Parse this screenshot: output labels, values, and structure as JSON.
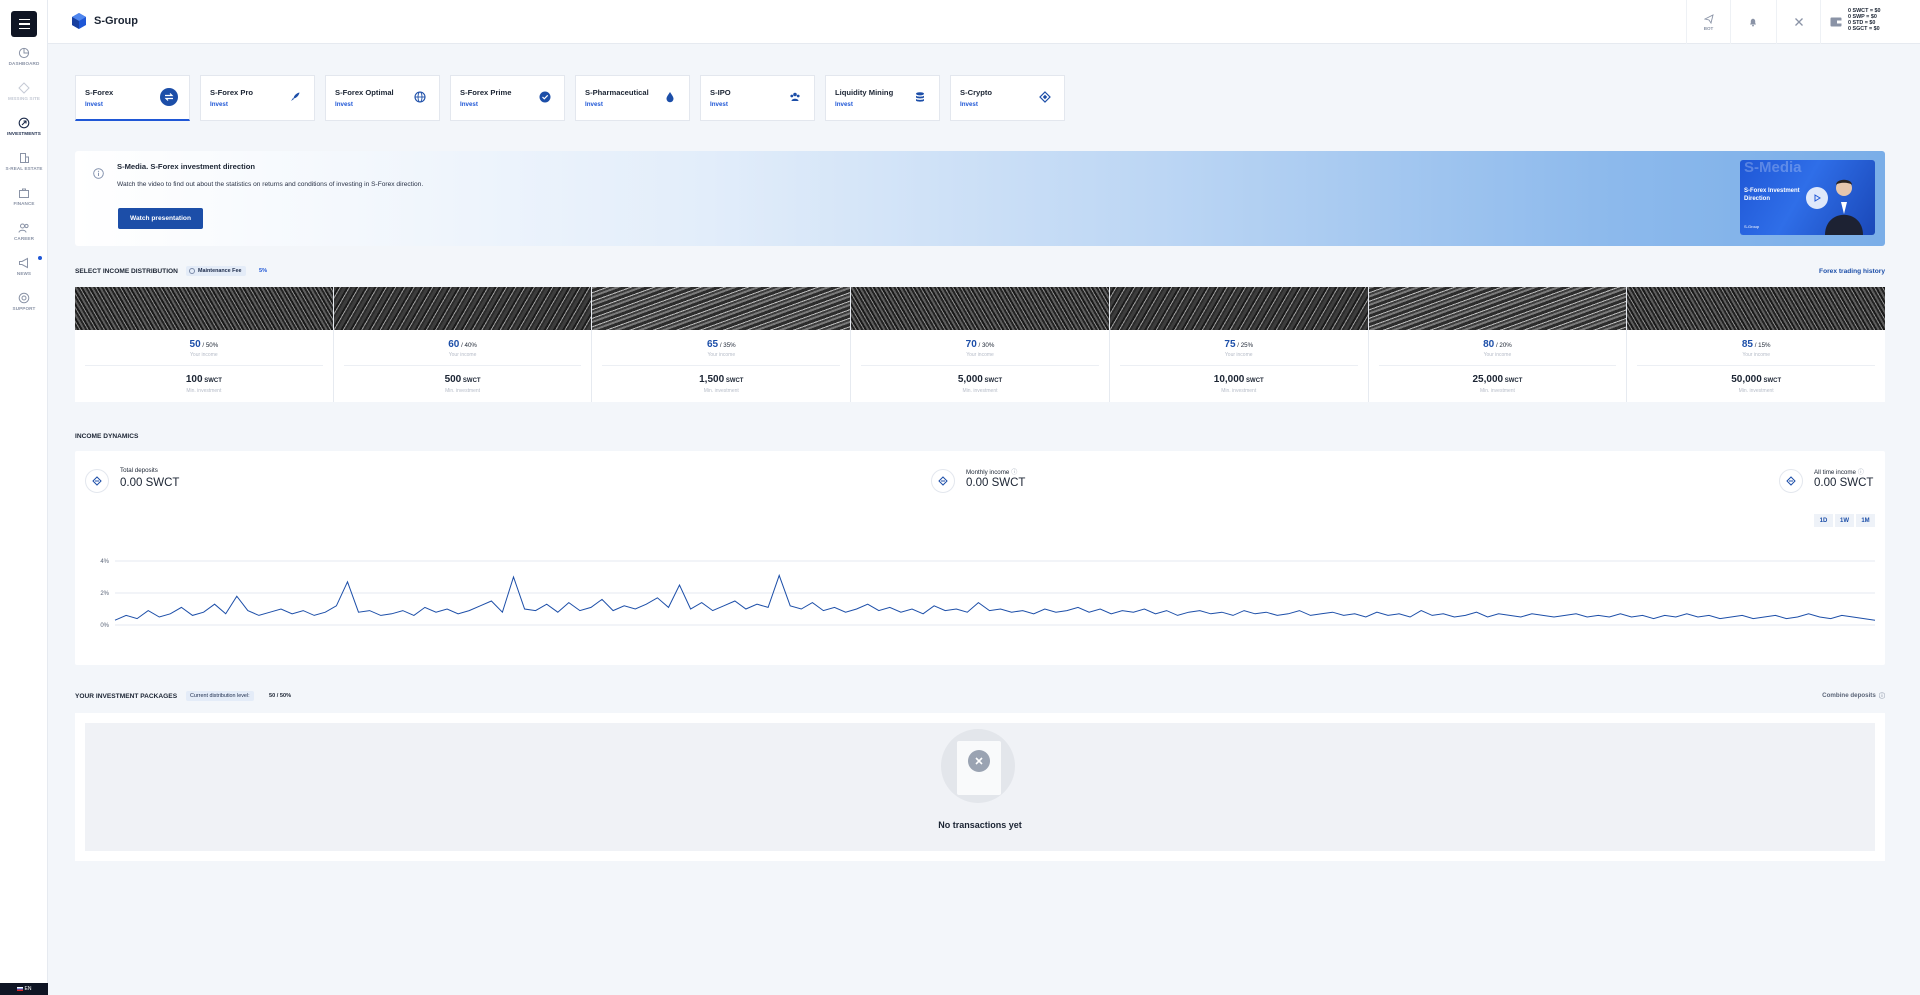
{
  "app": {
    "name": "S-Group"
  },
  "sidebar": {
    "items": [
      {
        "label": "DASHBOARD",
        "icon": "dashboard-icon"
      },
      {
        "label": "MISSING SITE",
        "icon": "diamond-icon"
      },
      {
        "label": "INVESTMENTS",
        "icon": "investments-icon"
      },
      {
        "label": "S-REAL ESTATE",
        "icon": "building-icon"
      },
      {
        "label": "FINANCE",
        "icon": "briefcase-icon"
      },
      {
        "label": "CAREER",
        "icon": "people-icon"
      },
      {
        "label": "NEWS",
        "icon": "megaphone-icon"
      },
      {
        "label": "SUPPORT",
        "icon": "support-icon"
      }
    ],
    "language": "EN"
  },
  "header": {
    "bot_label": "BOT",
    "wallet": [
      "0 SWCT = $0",
      "0 SWP = $0",
      "0 STD = $0",
      "0 SGCT = $0"
    ]
  },
  "tabs": [
    {
      "title": "S-Forex",
      "sub": "Invest",
      "icon": "exchange-icon"
    },
    {
      "title": "S-Forex Pro",
      "sub": "Invest",
      "icon": "rocket-icon"
    },
    {
      "title": "S-Forex Optimal",
      "sub": "Invest",
      "icon": "globe-icon"
    },
    {
      "title": "S-Forex Prime",
      "sub": "Invest",
      "icon": "check-badge-icon"
    },
    {
      "title": "S-Pharmaceutical",
      "sub": "Invest",
      "icon": "drop-icon"
    },
    {
      "title": "S-IPO",
      "sub": "Invest",
      "icon": "group-icon"
    },
    {
      "title": "Liquidity Mining",
      "sub": "Invest",
      "icon": "coins-icon"
    },
    {
      "title": "S-Crypto",
      "sub": "Invest",
      "icon": "crypto-icon"
    }
  ],
  "banner": {
    "title": "S-Media. S-Forex investment direction",
    "text": "Watch the video to find out about the statistics on returns and conditions of investing in S-Forex direction.",
    "button": "Watch presentation",
    "video_brand": "S-Media",
    "video_title": "S-Forex Investment Direction",
    "video_logo": "S-Group"
  },
  "distribution": {
    "title": "SELECT INCOME DISTRIBUTION",
    "fee_label": "Maintenance Fee",
    "fee_value": "5%",
    "link": "Forex trading history",
    "cards": [
      {
        "income": "50",
        "split": "/ 50%",
        "income_label": "Your income",
        "min": "100",
        "unit": "SWCT",
        "min_label": "Min. investment"
      },
      {
        "income": "60",
        "split": "/ 40%",
        "income_label": "Your income",
        "min": "500",
        "unit": "SWCT",
        "min_label": "Min. investment"
      },
      {
        "income": "65",
        "split": "/ 35%",
        "income_label": "Your income",
        "min": "1,500",
        "unit": "SWCT",
        "min_label": "Min. investment"
      },
      {
        "income": "70",
        "split": "/ 30%",
        "income_label": "Your income",
        "min": "5,000",
        "unit": "SWCT",
        "min_label": "Min. investment"
      },
      {
        "income": "75",
        "split": "/ 25%",
        "income_label": "Your income",
        "min": "10,000",
        "unit": "SWCT",
        "min_label": "Min. investment"
      },
      {
        "income": "80",
        "split": "/ 20%",
        "income_label": "Your income",
        "min": "25,000",
        "unit": "SWCT",
        "min_label": "Min. investment"
      },
      {
        "income": "85",
        "split": "/ 15%",
        "income_label": "Your income",
        "min": "50,000",
        "unit": "SWCT",
        "min_label": "Min. investment"
      }
    ]
  },
  "dynamics": {
    "title": "INCOME DYNAMICS",
    "stats": [
      {
        "label": "Total deposits",
        "value": "0.00 SWCT"
      },
      {
        "label": "Monthly income",
        "value": "0.00 SWCT"
      },
      {
        "label": "All time income",
        "value": "0.00 SWCT"
      }
    ],
    "ranges": [
      "1D",
      "1W",
      "1M"
    ]
  },
  "chart_data": {
    "type": "line",
    "y_ticks": [
      "4%",
      "2%",
      "0%"
    ],
    "ylim": [
      0,
      4
    ],
    "series": [
      {
        "color": "#1c4ea8",
        "values": [
          0.3,
          0.6,
          0.4,
          0.9,
          0.5,
          0.7,
          1.1,
          0.6,
          0.8,
          1.3,
          0.7,
          1.8,
          0.9,
          0.6,
          0.8,
          1.0,
          0.7,
          0.9,
          0.6,
          0.8,
          1.2,
          2.7,
          0.8,
          0.9,
          0.6,
          0.7,
          0.9,
          0.6,
          1.1,
          0.8,
          1.0,
          0.7,
          0.9,
          1.2,
          1.5,
          0.8,
          3.0,
          1.0,
          0.9,
          1.3,
          0.8,
          1.4,
          0.9,
          1.1,
          1.6,
          0.9,
          1.2,
          1.0,
          1.3,
          1.7,
          1.1,
          2.5,
          1.0,
          1.4,
          0.9,
          1.2,
          1.5,
          1.0,
          1.3,
          1.1,
          3.1,
          1.2,
          1.0,
          1.4,
          0.9,
          1.1,
          0.8,
          1.0,
          1.3,
          0.9,
          1.1,
          0.8,
          1.0,
          0.7,
          1.2,
          0.9,
          1.0,
          0.8,
          1.4,
          0.9,
          1.0,
          0.8,
          0.9,
          0.7,
          1.0,
          0.8,
          0.9,
          1.1,
          0.8,
          1.0,
          0.7,
          0.9,
          0.8,
          1.0,
          0.7,
          0.9,
          0.6,
          0.8,
          0.9,
          0.7,
          0.8,
          0.6,
          0.9,
          0.7,
          0.8,
          0.6,
          0.7,
          0.9,
          0.6,
          0.7,
          0.8,
          0.6,
          0.7,
          0.5,
          0.8,
          0.6,
          0.7,
          0.5,
          0.9,
          0.6,
          0.7,
          0.5,
          0.6,
          0.8,
          0.5,
          0.7,
          0.6,
          0.5,
          0.7,
          0.6,
          0.5,
          0.6,
          0.7,
          0.5,
          0.6,
          0.5,
          0.7,
          0.5,
          0.6,
          0.4,
          0.6,
          0.5,
          0.7,
          0.5,
          0.6,
          0.4,
          0.5,
          0.6,
          0.4,
          0.5,
          0.6,
          0.4,
          0.5,
          0.7,
          0.5,
          0.4,
          0.6,
          0.5,
          0.4,
          0.3
        ]
      }
    ]
  },
  "packages": {
    "title": "YOUR INVESTMENT PACKAGES",
    "chip_label": "Current distribution level:",
    "chip_value": "50 / 50%",
    "link": "Combine deposits",
    "empty": "No transactions yet"
  },
  "colors": {
    "accent": "#1f57d6",
    "dark": "#0f1524",
    "text": "#1b2433"
  }
}
